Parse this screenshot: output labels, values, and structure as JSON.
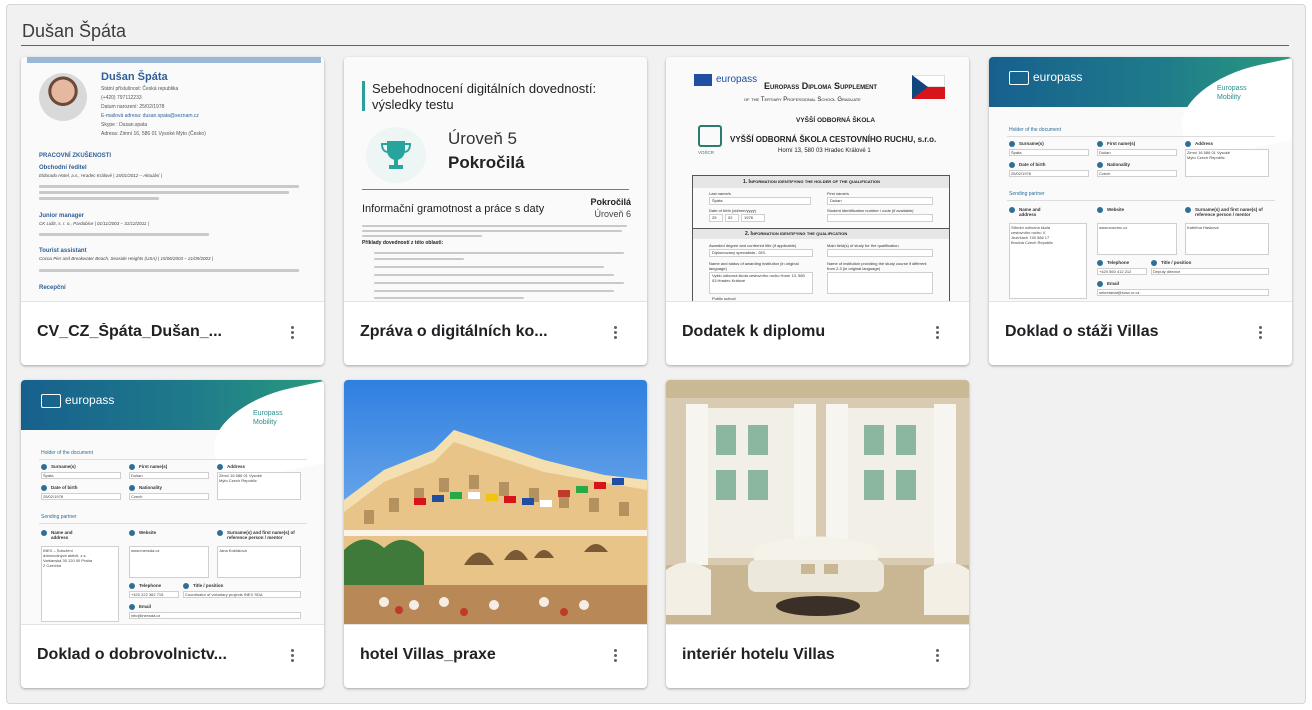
{
  "panel": {
    "title": "Dušan Špáta"
  },
  "cards": [
    {
      "title": "CV_CZ_Špáta_Dušan_...",
      "preview": "cv"
    },
    {
      "title": "Zpráva o digitálních ko...",
      "preview": "digital-report"
    },
    {
      "title": "Dodatek k diplomu",
      "preview": "diploma-supplement"
    },
    {
      "title": "Doklad o stáži Villas",
      "preview": "europass-mobility"
    },
    {
      "title": "Doklad o dobrovolnictv...",
      "preview": "europass-mobility"
    },
    {
      "title": "hotel Villas_praxe",
      "preview": "photo-hotel"
    },
    {
      "title": "interiér hotelu Villas",
      "preview": "photo-interior"
    }
  ],
  "cv": {
    "name": "Dušan Špáta",
    "line1": "Státní příslušnost: Česká republika",
    "line2": "(+420) 797112233",
    "line3": "Datum narození: 25/02/1978",
    "line4": "E-mailová adresa: dusan.spata@seznam.cz",
    "line5": "Skype : Dusan.spata",
    "line6": "Adresa: Zimní 16, 586 01 Vysoké Mýto (Česko)",
    "section1": "PRACOVNÍ ZKUŠENOSTI",
    "job1_title": "Obchodní ředitel",
    "job1_org": "Eldorado Hotel, a.s., Hradec Králové | 15/01/2012 – Aktuální |",
    "job2_title": "Junior manager",
    "job2_org": "CK Lidiz, s. r. o., Pardubice | 01/11/2003 – 31/12/2011 |",
    "job3_title": "Tourist assistant",
    "job3_org": "Cocoa Pier and Breakwater Beach, Seaside Heights (USA) | 15/06/2003 – 21/09/2003 |",
    "section2": "Recepční"
  },
  "digital": {
    "heading1": "Sebehodnocení digitálních dovedností:",
    "heading2": "výsledky testu",
    "level_label": "Úroveň 5",
    "level_name": "Pokročilá",
    "area": "Informační gramotnost a práce s daty",
    "area_level_name": "Pokročilá",
    "area_level": "Úroveň 6",
    "list_title": "Příklady dovedností z této oblasti:"
  },
  "diploma": {
    "brand": "europass",
    "title1": "Europass Diploma Supplement",
    "title2": "of the Tertiary Professional School Graduate",
    "school1": "VYŠŠÍ ODBORNÁ ŠKOLA",
    "school2": "VYŠŠÍ ODBORNÁ ŠKOLA CESTOVNÍHO RUCHU, s.r.o.",
    "school3": "Horní 13, 580 03 Hradec Králové 1",
    "sec1": "1.   Information identifying the holder of the qualification",
    "sec2": "2.   Information identifying the qualification",
    "f_last": "Last name/s",
    "v_last": "Špáta",
    "f_first": "First name/s",
    "v_first": "Dušan",
    "f_dob": "Date of birth (dd/mm/yyyy)",
    "v_dob1": "25",
    "v_dob2": "02",
    "v_dob3": "1978",
    "f_sid": "Student identification number / code (if available)",
    "f_deg": "Awarded degree and conferred title (if applicable)",
    "v_deg": "Diplomovaný specialista - DiS.",
    "f_main": "Main field(s) of study for the qualification",
    "f_inst": "Name and status of awarding institution (in original language)",
    "v_inst": "Vyšší odborná škola cestovního ruchu Horní 13, 580 03 Hradec Králové",
    "f_inst2": "Name of institution providing the study course if different from 2.3 (in original language)",
    "f_pub": "Public school",
    "seal": "VOŠCR"
  },
  "mobility": {
    "brand": "europass",
    "label1": "Europass",
    "label2": "Mobility",
    "holder": "Holder of the document",
    "f_surname": "Surname(s)",
    "f_first": "First name(s)",
    "f_address": "Address",
    "f_dob": "Date of birth",
    "f_nat": "Nationality",
    "v_surname": "Špáta",
    "v_first": "Dušan",
    "v_dob": "25/02/1978",
    "v_nat": "Czech",
    "v_address": "Zimní 16 586 01 Vysoké Mýto Czech Republic",
    "sending": "Sending partner",
    "f_name": "Name and address",
    "f_web": "Website",
    "f_ref": "Surname(s) and first name(s) of reference person / mentor",
    "f_tel": "Telephone",
    "f_title": "Title / position",
    "f_email": "Email",
    "a_name": "Střední odborná škola cestovního ruchu V. Jezírkách 745 586 17 Brodná Czech Republic",
    "a_web": "www.sosvmc.cz",
    "a_ref": "Kateřina Hasková",
    "a_tel": "+420 560 412 212",
    "a_title": "Deputy director",
    "a_email": "sekretariat@sosv-cr.cz",
    "b_name": "INEX – Sdružení dobrovolných aktivit, z.s. Varšavská 30 120 00 Praha 2 Czechia",
    "b_web": "www.inexsda.cz",
    "b_ref": "Jana Košťalová",
    "b_tel": "+420 222 362 715",
    "b_title": "Coordinator of voluntary projects INEX SDA",
    "b_email": "info@inexsda.cz"
  },
  "colors": {
    "accent": "#2f6fb0",
    "europass_teal": "#1e7a8a"
  }
}
